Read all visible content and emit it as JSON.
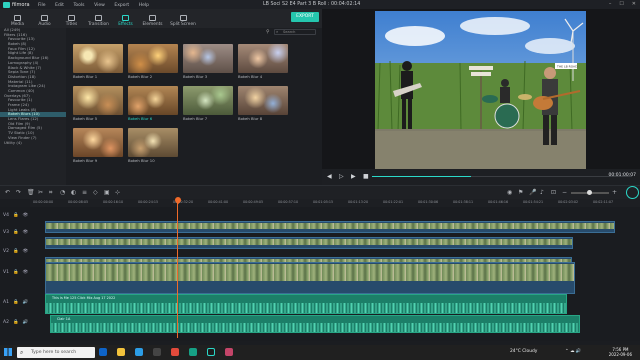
{
  "app": {
    "name": "filmora",
    "menu": [
      "File",
      "Edit",
      "Tools",
      "View",
      "Export",
      "Help"
    ],
    "project_title": "LB Soci S2 E4 Part 3 B Roll",
    "project_time": "00:04:02:14"
  },
  "top_tabs": [
    {
      "label": "Media",
      "icon": "media-icon"
    },
    {
      "label": "Audio",
      "icon": "music-icon"
    },
    {
      "label": "Titles",
      "icon": "titles-icon"
    },
    {
      "label": "Transition",
      "icon": "transition-icon"
    },
    {
      "label": "Effects",
      "icon": "effects-icon",
      "active": true
    },
    {
      "label": "Elements",
      "icon": "elements-icon"
    },
    {
      "label": "Split Screen",
      "icon": "split-screen-icon"
    }
  ],
  "export_label": "EXPORT",
  "categories": [
    {
      "label": "All (249)",
      "level": 0
    },
    {
      "label": "Filters (116)",
      "level": 0
    },
    {
      "label": "Favourite (13)",
      "level": 1
    },
    {
      "label": "Bokeh (8)",
      "level": 1
    },
    {
      "label": "Faux Film (12)",
      "level": 1
    },
    {
      "label": "Night Life (8)",
      "level": 1
    },
    {
      "label": "Background Blur (16)",
      "level": 1
    },
    {
      "label": "Lomography (4)",
      "level": 1
    },
    {
      "label": "Black & White (7)",
      "level": 1
    },
    {
      "label": "Sepia Tone (7)",
      "level": 1
    },
    {
      "label": "Distortion (18)",
      "level": 1
    },
    {
      "label": "Material (11)",
      "level": 1
    },
    {
      "label": "Instagram Like (24)",
      "level": 1
    },
    {
      "label": "Common (40)",
      "level": 1
    },
    {
      "label": "Overlays (67)",
      "level": 0
    },
    {
      "label": "Favourite (1)",
      "level": 1
    },
    {
      "label": "Frame (24)",
      "level": 1
    },
    {
      "label": "Light Leaks (8)",
      "level": 1
    },
    {
      "label": "Bokeh Blurs (10)",
      "level": 1,
      "highlight": true
    },
    {
      "label": "Lens Flares (12)",
      "level": 1
    },
    {
      "label": "Old Film (9)",
      "level": 1
    },
    {
      "label": "Damaged Film (5)",
      "level": 1
    },
    {
      "label": "TV Static (10)",
      "level": 1
    },
    {
      "label": "View Finder (7)",
      "level": 1
    },
    {
      "label": "Utility (4)",
      "level": 0
    }
  ],
  "search": {
    "placeholder": "Search"
  },
  "effects": [
    {
      "label": "Bokeh Blur 1"
    },
    {
      "label": "Bokeh Blur 2"
    },
    {
      "label": "Bokeh Blur 3"
    },
    {
      "label": "Bokeh Blur 4"
    },
    {
      "label": "Bokeh Blur 5"
    },
    {
      "label": "Bokeh Blur 6",
      "selected": true
    },
    {
      "label": "Bokeh Blur 7"
    },
    {
      "label": "Bokeh Blur 8"
    },
    {
      "label": "Bokeh Blur 9"
    },
    {
      "label": "Bokeh Blur 10"
    }
  ],
  "preview": {
    "timecode": "00:01:00:07",
    "progress": 0.38,
    "sign_label": "THE LB ROAD"
  },
  "ruler_labels": [
    "00:00:00:00",
    "00:00:08:05",
    "00:00:16:10",
    "00:00:24:15",
    "00:00:32:20",
    "00:00:41:00",
    "00:00:49:05",
    "00:00:57:10",
    "00:01:05:15",
    "00:01:13:20",
    "00:01:22:01",
    "00:01:30:06",
    "00:01:38:11",
    "00:01:46:16",
    "00:01:54:21",
    "00:02:03:02",
    "00:02:11:07"
  ],
  "tracks": {
    "video_tracks": [
      "V4",
      "V3",
      "V2",
      "V1"
    ],
    "audio_tracks": [
      "A1",
      "A2"
    ],
    "audio_clip_1": "This is Me 125 Click Mix Aug 17 2022",
    "audio_clip_2": "Clair 1A"
  },
  "taskbar": {
    "search_placeholder": "Type here to search",
    "weather": "24°C  Cloudy",
    "time": "7:56 PM",
    "date": "2022-09-06"
  },
  "colors": {
    "accent": "#2bd8c8",
    "playhead": "#ef6a2a",
    "video_clip": "#274b6c",
    "audio_clip": "#1c7f68"
  }
}
